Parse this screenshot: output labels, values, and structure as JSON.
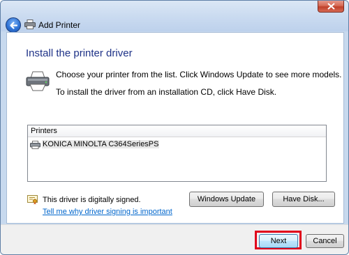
{
  "window": {
    "title": "Add Printer",
    "close_tooltip_icon": "close-icon"
  },
  "main": {
    "heading": "Install the printer driver",
    "instruction_1": "Choose your printer from the list. Click Windows Update to see more models.",
    "instruction_2": "To install the driver from an installation CD, click Have Disk."
  },
  "printer_list": {
    "column_header": "Printers",
    "items": [
      {
        "label": "KONICA MINOLTA C364SeriesPS",
        "icon": "printer-icon"
      }
    ]
  },
  "signing": {
    "status_text": "This driver is digitally signed.",
    "link_text": "Tell me why driver signing is important"
  },
  "buttons": {
    "windows_update": "Windows Update",
    "have_disk": "Have Disk...",
    "next": "Next",
    "cancel": "Cancel"
  },
  "colors": {
    "heading": "#1e3287",
    "link": "#0066cc",
    "highlight_box": "#e0001b"
  }
}
